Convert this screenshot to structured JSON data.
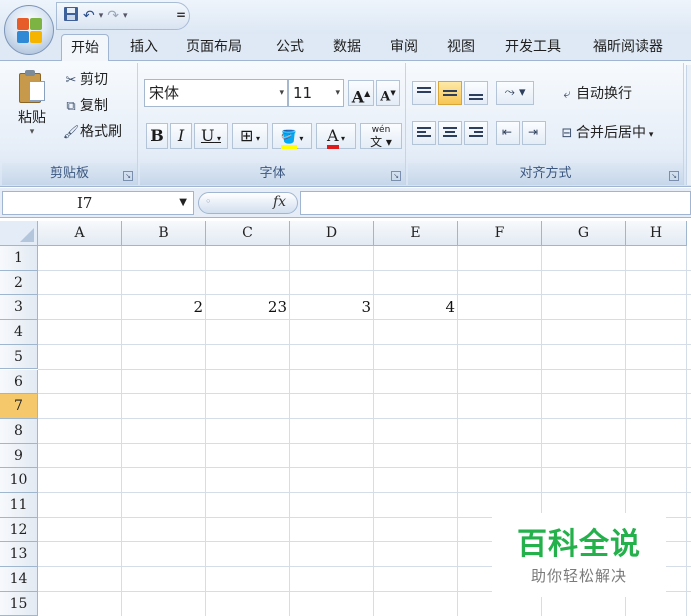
{
  "quick_access": {
    "save_icon": "save-icon",
    "undo_icon": "undo-icon",
    "redo_icon": "redo-icon",
    "customize_symbol": "="
  },
  "tabs": [
    "开始",
    "插入",
    "页面布局",
    "公式",
    "数据",
    "审阅",
    "视图",
    "开发工具",
    "福昕阅读器"
  ],
  "active_tab": "开始",
  "clipboard": {
    "paste": "粘贴",
    "cut": "剪切",
    "copy": "复制",
    "format_painter": "格式刷",
    "group_label": "剪贴板"
  },
  "font": {
    "name": "宋体",
    "size": "11",
    "grow": "A",
    "shrink": "A",
    "bold": "B",
    "italic": "I",
    "underline": "U",
    "font_color_letter": "A",
    "phonetic": "wén",
    "group_label": "字体"
  },
  "alignment": {
    "wrap_text": "自动换行",
    "merge_center": "合并后居中",
    "group_label": "对齐方式"
  },
  "formula_bar": {
    "name_box": "I7",
    "fx": "fx",
    "value": ""
  },
  "sheet": {
    "columns": [
      "A",
      "B",
      "C",
      "D",
      "E",
      "F",
      "G",
      "H"
    ],
    "rows": [
      "1",
      "2",
      "3",
      "4",
      "5",
      "6",
      "7",
      "8",
      "9",
      "10",
      "11",
      "12",
      "13",
      "14",
      "15"
    ],
    "selected_row": "7",
    "cells": {
      "B3": "2",
      "C3": "23",
      "D3": "3",
      "E3": "4"
    }
  },
  "watermark": {
    "title": "百科全说",
    "subtitle": "助你轻松解决"
  },
  "colors": {
    "accent_green": "#24b04b",
    "selected_row_header": "#f5c96b",
    "ribbon_blue": "#dfe9f5"
  }
}
